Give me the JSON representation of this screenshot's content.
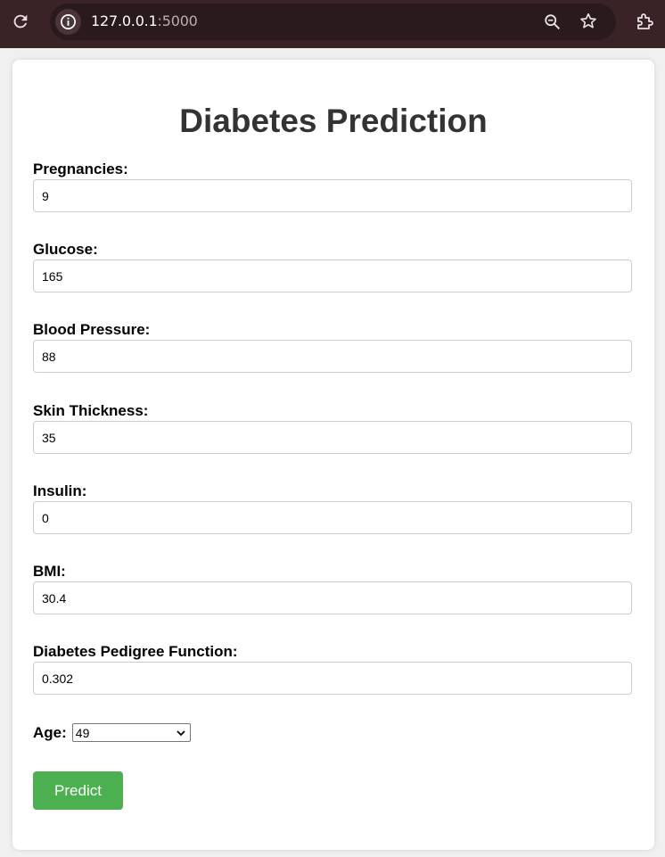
{
  "browser": {
    "url_host": "127.0.0.1",
    "url_port": ":5000",
    "bar_color": "#3a2326"
  },
  "page": {
    "title": "Diabetes Prediction",
    "fields": [
      {
        "label": "Pregnancies:",
        "value": "9"
      },
      {
        "label": "Glucose:",
        "value": "165"
      },
      {
        "label": "Blood Pressure:",
        "value": "88"
      },
      {
        "label": "Skin Thickness:",
        "value": "35"
      },
      {
        "label": "Insulin:",
        "value": "0"
      },
      {
        "label": "BMI:",
        "value": "30.4"
      },
      {
        "label": "Diabetes Pedigree Function:",
        "value": "0.302"
      }
    ],
    "age": {
      "label": "Age:",
      "selected": "49"
    },
    "predict_label": "Predict",
    "button_color": "#4caf50"
  },
  "icons": [
    "reload-icon",
    "site-info-icon",
    "zoom-icon",
    "star-icon",
    "extensions-icon",
    "chevron-down-icon"
  ]
}
